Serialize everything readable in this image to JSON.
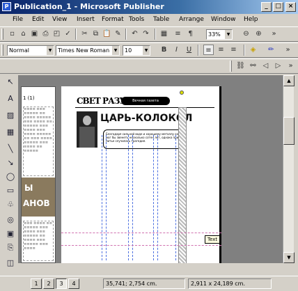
{
  "window": {
    "title": "Publication_1 - Microsoft Publisher"
  },
  "menu": [
    "File",
    "Edit",
    "View",
    "Insert",
    "Format",
    "Tools",
    "Table",
    "Arrange",
    "Window",
    "Help"
  ],
  "standard_toolbar": {
    "zoom": "33%"
  },
  "formatting_toolbar": {
    "style": "Normal",
    "font": "Times New Roman",
    "size": "10"
  },
  "document": {
    "masthead": "СВЕТ РАЗУМА",
    "badge": "Вечная газета",
    "headline": "ЦАРЬ-КОЛОКОЛ",
    "body_text": "Благодаря сильной воде и хорошему металлу он мог бы звенеть несколько сотен лет, однако при литье случилась трагедия.",
    "side_graphic_text": [
      "Ы",
      "АНОВ"
    ],
    "left_page_header": "1 (1)",
    "tooltip": "Text"
  },
  "status": {
    "pages": [
      "1",
      "2",
      "3",
      "4"
    ],
    "active_page": "3",
    "position": "35,741; 2,754 cm.",
    "size": "2,911 x 24,189 cm."
  },
  "colors": {
    "titlebar": "#0a246a",
    "guides": "#4b6fe0",
    "margin_guides": "#d070b0"
  }
}
